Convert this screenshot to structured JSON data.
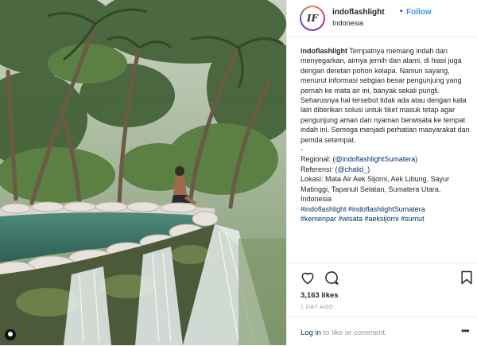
{
  "header": {
    "avatar_initials": "IF",
    "username": "indoflashlight",
    "separator": "•",
    "follow_label": "Follow",
    "location": "Indonesia"
  },
  "caption": {
    "username": "indoflashlight",
    "body": " Tempatnya memang indah dan menyegarkan, airnya jernih dan alami, di hiasi juga dengan deretan pohon kelapa. Namun sayang, menurut informasi sebgian besar pengunjung yang pernah ke mata air ini, banyak sekali pungli. Seharusnya hal tersebut tidak ada atau dengan kata lain diberikan solusi untuk tiket masuk tetap agar pengunjung aman dan nyaman berwisata ke tempat indah ini. Semoga menjadi perhatian masyarakat dan pemda setempat.",
    "dash": "-",
    "regional_label": "Regional: (",
    "regional_link": "@indoflashlightSumatera",
    "regional_end": ")",
    "referensi_label": "Referensi: (",
    "referensi_link": "@chalid_",
    "referensi_end": ")",
    "lokasi": "Lokasi: Mata Air Aek Sijorni, Aek Libung, Sayur Matinggi, Tapanuli Selatan, Sumatera Utara, Indonesia",
    "hashtags_1": "#indoflashlight #indoflashlightSumatera",
    "hashtags_2": "#kemenpar #wisata #aeksijorni #sumut"
  },
  "actions": {
    "like_icon": "heart-icon",
    "comment_icon": "comment-icon",
    "save_icon": "bookmark-icon"
  },
  "likes": "3,163 likes",
  "time_ago": "1 DAY AGO",
  "comment_bar": {
    "login_label": "Log in",
    "login_suffix": " to like or comment.",
    "more_label": "•••"
  },
  "colors": {
    "accent": "#3897f0",
    "link": "#003569",
    "muted": "#999999"
  }
}
